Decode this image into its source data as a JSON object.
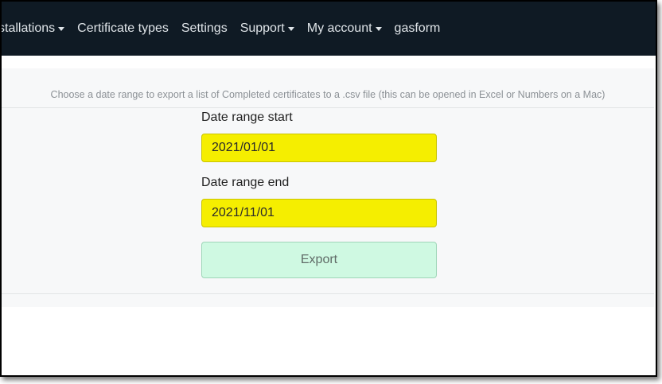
{
  "nav": {
    "items": [
      {
        "label": "stallations",
        "dropdown": true
      },
      {
        "label": "Certificate types",
        "dropdown": false
      },
      {
        "label": "Settings",
        "dropdown": false
      },
      {
        "label": "Support",
        "dropdown": true
      },
      {
        "label": "My account",
        "dropdown": true
      },
      {
        "label": "gasform",
        "dropdown": false
      }
    ]
  },
  "export": {
    "instructions": "Choose a date range to export a list of Completed certificates to a .csv file (this can be opened in Excel or Numbers on a Mac)",
    "start_label": "Date range start",
    "start_value": "2021/01/01",
    "end_label": "Date range end",
    "end_value": "2021/11/01",
    "button_label": "Export"
  },
  "colors": {
    "navbar": "#0f1a24",
    "input_highlight": "#f5ee00",
    "export_button": "#cff9e2"
  }
}
